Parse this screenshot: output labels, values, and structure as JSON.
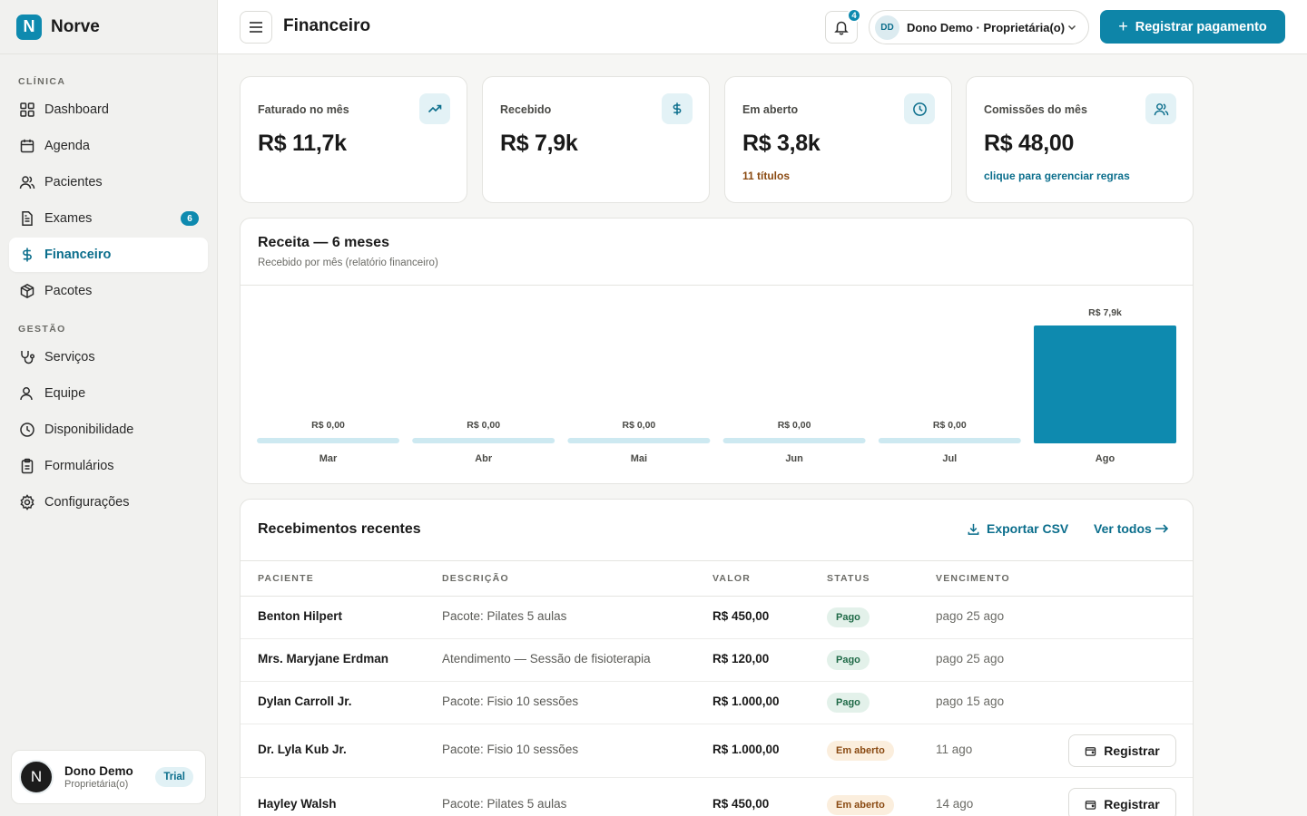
{
  "brand": {
    "logo_letter": "N",
    "name": "Norve"
  },
  "colors": {
    "accent": "#0e85a8",
    "bar_primary": "#0e8aaf",
    "bar_empty": "#cde9f1",
    "paid": "#1f6a47",
    "open": "#8a4a12"
  },
  "sidebar": {
    "section_clinic": "CLÍNICA",
    "section_manage": "GESTÃO",
    "items": [
      {
        "label": "Dashboard",
        "icon": "grid-icon"
      },
      {
        "label": "Agenda",
        "icon": "calendar-icon"
      },
      {
        "label": "Pacientes",
        "icon": "users-icon"
      },
      {
        "label": "Exames",
        "icon": "file-icon",
        "badge": "6"
      },
      {
        "label": "Financeiro",
        "icon": "dollar-icon",
        "active": true
      },
      {
        "label": "Pacotes",
        "icon": "package-icon"
      },
      {
        "label": "Serviços",
        "icon": "stethoscope-icon"
      },
      {
        "label": "Equipe",
        "icon": "team-icon"
      },
      {
        "label": "Disponibilidade",
        "icon": "clock-icon"
      },
      {
        "label": "Formulários",
        "icon": "clipboard-icon"
      },
      {
        "label": "Configurações",
        "icon": "gear-icon"
      }
    ],
    "user": {
      "initial": "N",
      "name": "Dono Demo",
      "role": "Proprietária(o)",
      "plan": "Trial"
    }
  },
  "header": {
    "title": "Financeiro",
    "notifications": "4",
    "account_initials": "DD",
    "account_label": "Dono Demo · Proprietária(o)",
    "primary_action": "Registrar pagamento"
  },
  "stats": [
    {
      "label": "Faturado no mês",
      "value": "R$ 11,7k",
      "sub": "",
      "icon": "trending-up-icon"
    },
    {
      "label": "Recebido",
      "value": "R$ 7,9k",
      "sub": "",
      "icon": "dollar-icon"
    },
    {
      "label": "Em aberto",
      "value": "R$ 3,8k",
      "sub": "11 títulos",
      "icon": "clock-icon"
    },
    {
      "label": "Comissões do mês",
      "value": "R$ 48,00",
      "sub": "clique para gerenciar regras",
      "icon": "users-icon"
    }
  ],
  "revenue": {
    "title": "Receita — 6 meses",
    "subtitle": "Recebido por mês (relatório financeiro)"
  },
  "chart_data": {
    "type": "bar",
    "title": "Receita — 6 meses",
    "categories": [
      "Mar",
      "Abr",
      "Mai",
      "Jun",
      "Jul",
      "Ago"
    ],
    "values": [
      0,
      0,
      0,
      0,
      0,
      7900
    ],
    "value_labels": [
      "R$ 0,00",
      "R$ 0,00",
      "R$ 0,00",
      "R$ 0,00",
      "R$ 0,00",
      "R$ 7,9k"
    ],
    "ylim": [
      0,
      7900
    ],
    "grid": false
  },
  "receipts": {
    "title": "Recebimentos recentes",
    "export_label": "Exportar CSV",
    "view_all_label": "Ver todos",
    "columns": [
      "PACIENTE",
      "DESCRIÇÃO",
      "VALOR",
      "STATUS",
      "VENCIMENTO"
    ],
    "action_label": "Registrar",
    "rows": [
      {
        "patient": "Benton Hilpert",
        "description": "Pacote: Pilates 5 aulas",
        "value": "R$ 450,00",
        "status": "Pago",
        "due": "pago 25 ago"
      },
      {
        "patient": "Mrs. Maryjane Erdman",
        "description": "Atendimento — Sessão de fisioterapia",
        "value": "R$ 120,00",
        "status": "Pago",
        "due": "pago 25 ago"
      },
      {
        "patient": "Dylan Carroll Jr.",
        "description": "Pacote: Fisio 10 sessões",
        "value": "R$ 1.000,00",
        "status": "Pago",
        "due": "pago 15 ago"
      },
      {
        "patient": "Dr. Lyla Kub Jr.",
        "description": "Pacote: Fisio 10 sessões",
        "value": "R$ 1.000,00",
        "status": "Em aberto",
        "due": "11 ago"
      },
      {
        "patient": "Hayley Walsh",
        "description": "Pacote: Pilates 5 aulas",
        "value": "R$ 450,00",
        "status": "Em aberto",
        "due": "14 ago"
      }
    ]
  }
}
